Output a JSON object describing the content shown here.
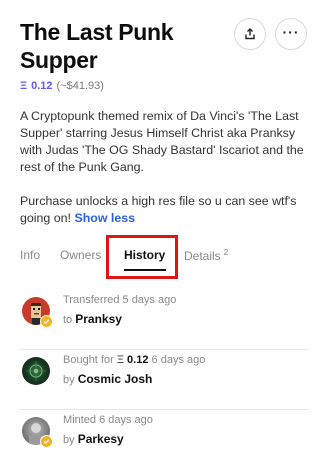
{
  "item": {
    "title": "The Last Punk Supper",
    "price_symbol": "Ξ",
    "price": "0.12",
    "price_usd": "(~$41.93)",
    "description_p1": "A Cryptopunk themed remix of Da Vinci's 'The Last Supper' starring Jesus Himself Christ aka Pranksy with Judas 'The OG Shady Bastard' Iscariot and the rest of the Punk Gang.",
    "description_p2": "Purchase unlocks a high res file so u can see wtf's going on!",
    "show_less_label": "Show less"
  },
  "actions": {
    "share_icon": "share-icon",
    "more_label": "···"
  },
  "tabs": [
    {
      "label": "Info"
    },
    {
      "label": "Owners"
    },
    {
      "label": "History",
      "active": true
    },
    {
      "label": "Details",
      "badge": "2"
    }
  ],
  "history": [
    {
      "action": "Transferred",
      "eth_symbol": "",
      "value": "",
      "time": "5 days ago",
      "prep": "to",
      "user": "Pranksy"
    },
    {
      "action": "Bought for",
      "eth_symbol": "Ξ",
      "value": "0.12",
      "time": "6 days ago",
      "prep": "by",
      "user": "Cosmic Josh"
    },
    {
      "action": "Minted",
      "eth_symbol": "",
      "value": "",
      "time": "6 days ago",
      "prep": "by",
      "user": "Parkesy"
    }
  ],
  "colors": {
    "accent_eth": "#5f5cf4",
    "link": "#2a5fe0",
    "highlight": "#e01515",
    "verified": "#f0b429"
  }
}
